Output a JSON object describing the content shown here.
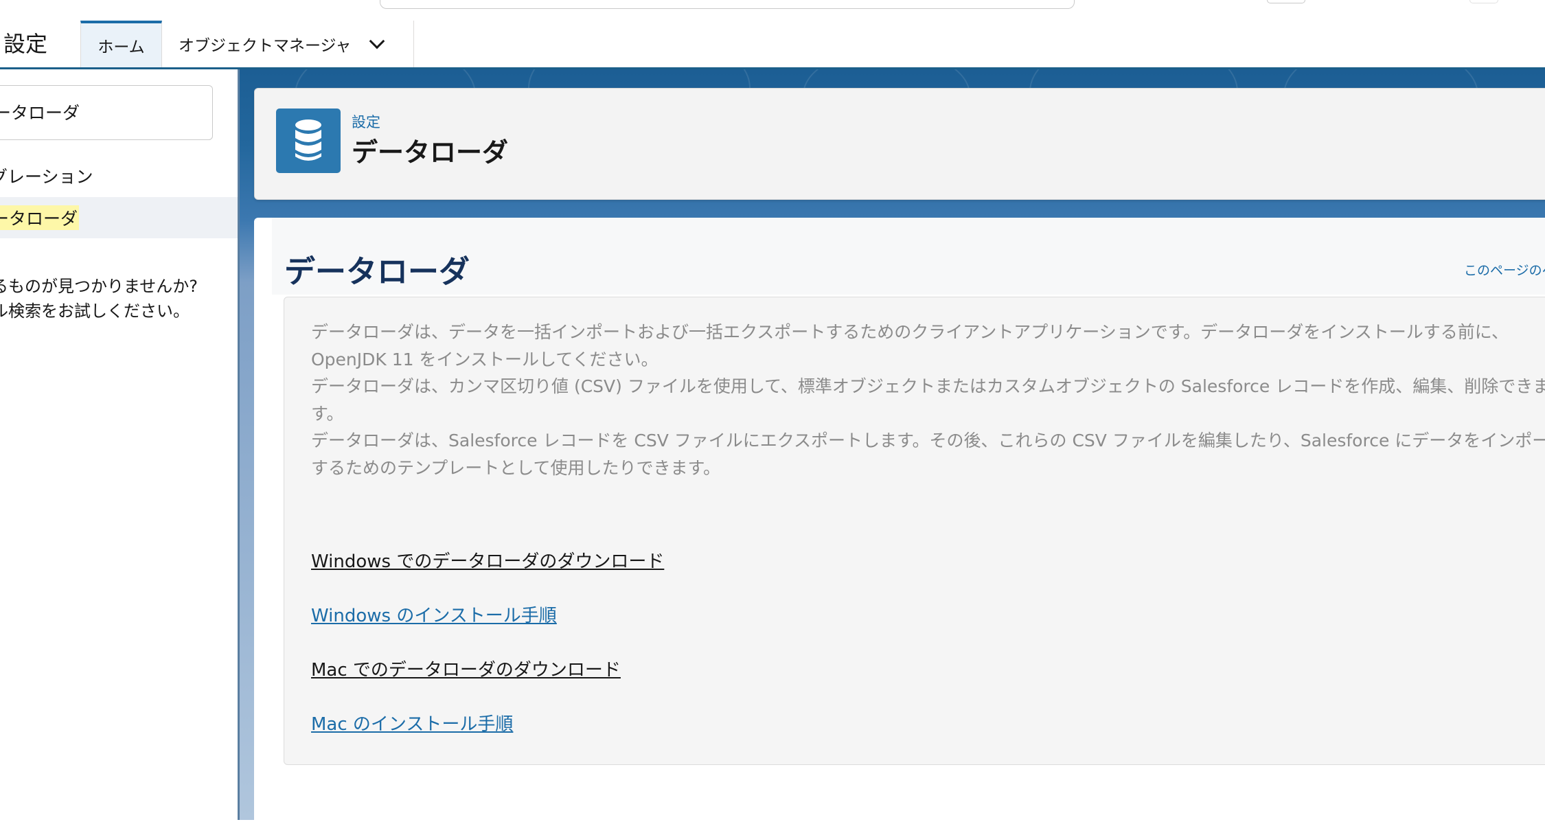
{
  "app": {
    "name": "設定"
  },
  "nav": {
    "tabs": [
      {
        "label": "ホーム",
        "active": true
      },
      {
        "label": "オブジェクトマネージャ",
        "active": false
      }
    ]
  },
  "sidebar": {
    "quickfind_value": "ータローダ",
    "items": [
      {
        "label": "グレーション"
      },
      {
        "label": "ータローダ",
        "selected": true
      }
    ],
    "help_text": "るものが見つかりませんか?\nル検索をお試しください。"
  },
  "page_header": {
    "breadcrumb": "設定",
    "title": "データローダ",
    "icon": "database-icon"
  },
  "content": {
    "title": "データローダ",
    "help_link": "このページのヘ",
    "paragraphs": [
      "データローダは、データを一括インポートおよび一括エクスポートするためのクライアントアプリケーションです。データローダをインストールする前に、OpenJDK 11 をインストールしてください。",
      "データローダは、カンマ区切り値 (CSV) ファイルを使用して、標準オブジェクトまたはカスタムオブジェクトの Salesforce レコードを作成、編集、削除できます。",
      "データローダは、Salesforce レコードを CSV ファイルにエクスポートします。その後、これらの CSV ファイルを編集したり、Salesforce にデータをインポートするためのテンプレートとして使用したりできます。"
    ],
    "links": [
      {
        "label": "Windows でのデータローダのダウンロード",
        "style": "dark"
      },
      {
        "label": "Windows のインストール手順",
        "style": "blue"
      },
      {
        "label": "Mac でのデータローダのダウンロード",
        "style": "dark"
      },
      {
        "label": "Mac のインストール手順",
        "style": "blue"
      }
    ]
  },
  "colors": {
    "accent": "#1b6ca8",
    "header_tile": "#2c79b0",
    "title_navy": "#16325c",
    "highlight": "#fdf7a8"
  }
}
